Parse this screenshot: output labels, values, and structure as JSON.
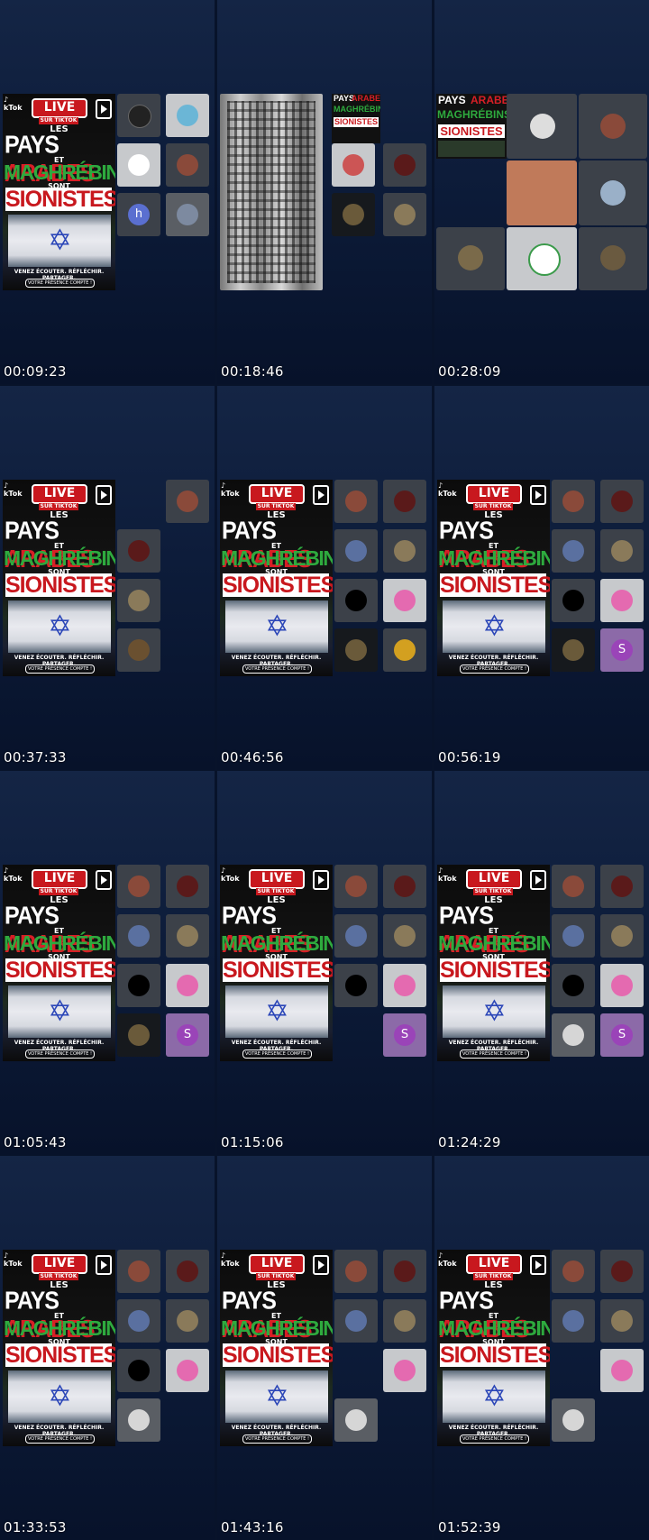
{
  "poster": {
    "tiktok": "♪\ntok",
    "live": "LIVE",
    "sur_tiktok": "SUR TIKTOK",
    "les": "LES",
    "pays": "PAYS",
    "arabes": "ARABES",
    "et": "ET",
    "maghrebins": "MAGHRÉBINS",
    "sont": "SONT",
    "sionistes": "SIONISTES",
    "footer": "VENEZ ÉCOUTER. RÉFLÉCHIR. PARTAGER.",
    "footer2": "VOTRE PRÉSENCE COMPTE !"
  },
  "timestamps": [
    "00:09:23",
    "00:18:46",
    "00:28:09",
    "00:37:33",
    "00:46:56",
    "00:56:19",
    "01:05:43",
    "01:15:06",
    "01:24:29",
    "01:33:53",
    "01:43:16",
    "01:52:39"
  ],
  "avatar_letters": {
    "h": "h",
    "s": "S"
  },
  "colors": {
    "bg": "#0d1c3a",
    "red": "#c8181e",
    "green": "#2eaa3e",
    "purple": "#8c6aa8",
    "blue_avatar": "#5a6fd0"
  }
}
